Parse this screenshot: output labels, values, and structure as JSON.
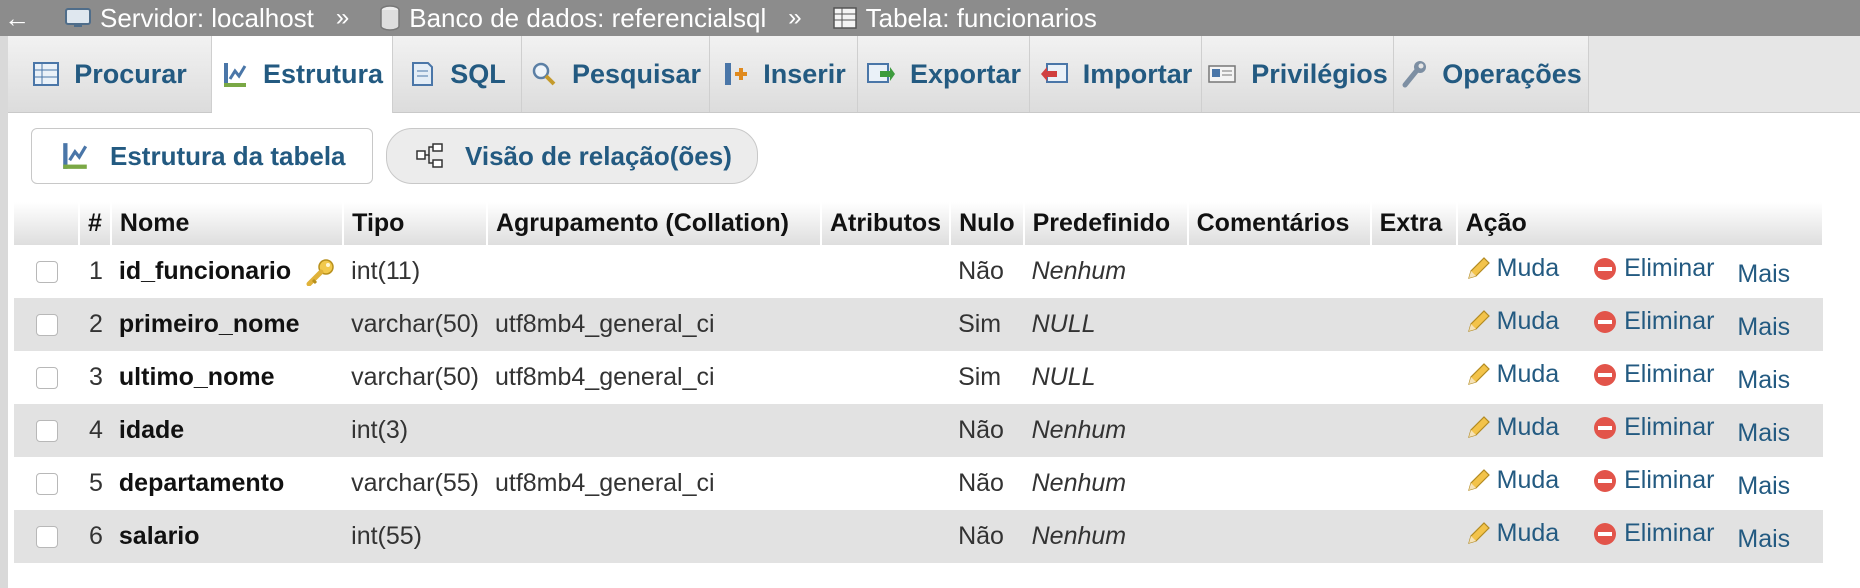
{
  "breadcrumb": {
    "server": "Servidor: localhost",
    "database": "Banco de dados: referencialsql",
    "table": "Tabela: funcionarios",
    "separator": "»"
  },
  "tabs": [
    {
      "label": "Procurar",
      "icon": "browse-icon"
    },
    {
      "label": "Estrutura",
      "icon": "structure-icon",
      "active": true
    },
    {
      "label": "SQL",
      "icon": "sql-icon"
    },
    {
      "label": "Pesquisar",
      "icon": "search-icon"
    },
    {
      "label": "Inserir",
      "icon": "insert-icon"
    },
    {
      "label": "Exportar",
      "icon": "export-icon"
    },
    {
      "label": "Importar",
      "icon": "import-icon"
    },
    {
      "label": "Privilégios",
      "icon": "privileges-icon"
    },
    {
      "label": "Operações",
      "icon": "operations-icon"
    }
  ],
  "subtabs": {
    "table_structure": "Estrutura da tabela",
    "relation_view": "Visão de relação(ões)"
  },
  "columns": [
    "#",
    "Nome",
    "Tipo",
    "Agrupamento (Collation)",
    "Atributos",
    "Nulo",
    "Predefinido",
    "Comentários",
    "Extra",
    "Ação"
  ],
  "actions": {
    "change": "Muda",
    "drop": "Eliminar",
    "more": "Mais"
  },
  "rows": [
    {
      "num": "1",
      "name": "id_funcionario",
      "type": "int(11)",
      "collation": "",
      "attributes": "",
      "null": "Não",
      "default": "Nenhum",
      "comments": "",
      "extra": "",
      "primary_key": true
    },
    {
      "num": "2",
      "name": "primeiro_nome",
      "type": "varchar(50)",
      "collation": "utf8mb4_general_ci",
      "attributes": "",
      "null": "Sim",
      "default": "NULL",
      "comments": "",
      "extra": ""
    },
    {
      "num": "3",
      "name": "ultimo_nome",
      "type": "varchar(50)",
      "collation": "utf8mb4_general_ci",
      "attributes": "",
      "null": "Sim",
      "default": "NULL",
      "comments": "",
      "extra": ""
    },
    {
      "num": "4",
      "name": "idade",
      "type": "int(3)",
      "collation": "",
      "attributes": "",
      "null": "Não",
      "default": "Nenhum",
      "comments": "",
      "extra": ""
    },
    {
      "num": "5",
      "name": "departamento",
      "type": "varchar(55)",
      "collation": "utf8mb4_general_ci",
      "attributes": "",
      "null": "Não",
      "default": "Nenhum",
      "comments": "",
      "extra": ""
    },
    {
      "num": "6",
      "name": "salario",
      "type": "int(55)",
      "collation": "",
      "attributes": "",
      "null": "Não",
      "default": "Nenhum",
      "comments": "",
      "extra": ""
    }
  ],
  "colors": {
    "link": "#235a81",
    "breadcrumb_bg": "#8c8c8c",
    "row_alt": "#e2e2e2"
  }
}
